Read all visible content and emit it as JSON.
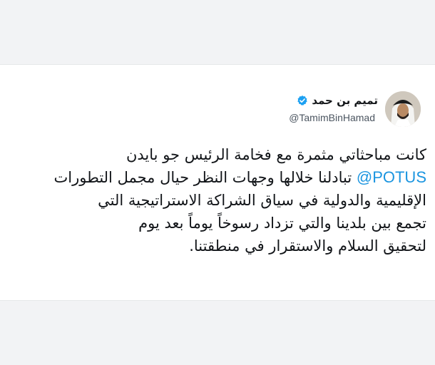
{
  "tweet": {
    "display_name": "تميم بن حمد",
    "handle": "@TamimBinHamad",
    "verified": true,
    "colors": {
      "link": "#1b95e0",
      "verified_badge": "#1da1f2",
      "text": "#111418"
    },
    "body": {
      "line1": "كانت مباحثاتي مثمرة مع فخامة الرئيس جو بايدن",
      "mention": "@POTUS",
      "line2_rest": "تبادلنا خلالها وجهات النظر حيال مجمل التطورات",
      "line3": "الإقليمية والدولية في سياق الشراكة الاستراتيجية التي",
      "line4": "تجمع بين بلدينا والتي تزداد رسوخاً يوماً بعد يوم",
      "line5": "لتحقيق السلام والاستقرار في منطقتنا."
    }
  }
}
